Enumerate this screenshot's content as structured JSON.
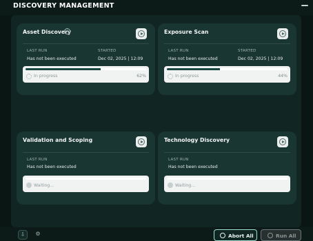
{
  "header": {
    "title": "DISCOVERY MANAGEMENT"
  },
  "cards": [
    {
      "title": "Asset Discovery",
      "last_run_label": "LAST RUN",
      "last_run_value": "Has not been executed",
      "started_label": "STARTED",
      "started_value": "Dec 02, 2025 | 12:09",
      "status": "In progress",
      "percent_text": "62%",
      "progress": 0.62
    },
    {
      "title": "Exposure Scan",
      "last_run_label": "LAST RUN",
      "last_run_value": "Has not been executed",
      "started_label": "STARTED",
      "started_value": "Dec 02, 2025 | 12:09",
      "status": "In progress",
      "percent_text": "44%",
      "progress": 0.44
    },
    {
      "title": "Validation and Scoping",
      "last_run_label": "LAST RUN",
      "last_run_value": "Has not been executed",
      "status": "Waiting...",
      "progress": 0
    },
    {
      "title": "Technology Discovery",
      "last_run_label": "LAST RUN",
      "last_run_value": "Has not been executed",
      "status": "Waiting...",
      "progress": 0
    }
  ],
  "footer": {
    "abort_label": "Abort All",
    "run_label": "Run All"
  },
  "icons": {
    "info": "info-icon",
    "play": "play-icon",
    "spinner": "spinner-icon",
    "download": "download-icon",
    "settings": "gear-icon",
    "stop": "stop-icon"
  },
  "colors": {
    "background": "#0a1614",
    "card": "#1a3633",
    "progress_fill": "#184741",
    "abort_border": "#9fe0d0"
  }
}
